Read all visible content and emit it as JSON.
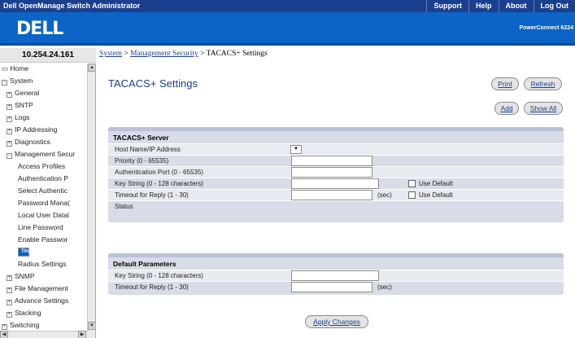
{
  "topbar": {
    "app_title": "Dell OpenManage Switch Administrator",
    "links": [
      "Support",
      "Help",
      "About",
      "Log Out"
    ]
  },
  "header": {
    "logo": "DELL",
    "product": "PowerConnect 6224"
  },
  "left": {
    "ip": "10.254.24.161",
    "nav": [
      {
        "label": "Home",
        "level": 0,
        "type": "leaf-icon"
      },
      {
        "label": "System",
        "level": 0,
        "type": "expanded"
      },
      {
        "label": "General",
        "level": 1,
        "type": "collapsed"
      },
      {
        "label": "SNTP",
        "level": 1,
        "type": "collapsed"
      },
      {
        "label": "Logs",
        "level": 1,
        "type": "collapsed"
      },
      {
        "label": "IP Addressing",
        "level": 1,
        "type": "collapsed"
      },
      {
        "label": "Diagnostics",
        "level": 1,
        "type": "collapsed"
      },
      {
        "label": "Management Secur",
        "level": 1,
        "type": "expanded"
      },
      {
        "label": "Access Profiles",
        "level": 2,
        "type": "leaf"
      },
      {
        "label": "Authentication P",
        "level": 2,
        "type": "leaf"
      },
      {
        "label": "Select Authentic",
        "level": 2,
        "type": "leaf"
      },
      {
        "label": "Password Mana(",
        "level": 2,
        "type": "leaf"
      },
      {
        "label": "Local User Datal",
        "level": 2,
        "type": "leaf"
      },
      {
        "label": "Line Password",
        "level": 2,
        "type": "leaf"
      },
      {
        "label": "Enable Passwor",
        "level": 2,
        "type": "leaf"
      },
      {
        "label": "TACACS+ Setti",
        "level": 2,
        "type": "selected"
      },
      {
        "label": "Radius Settings",
        "level": 2,
        "type": "leaf"
      },
      {
        "label": "SNMP",
        "level": 1,
        "type": "collapsed"
      },
      {
        "label": "File Management",
        "level": 1,
        "type": "collapsed"
      },
      {
        "label": "Advance Settings",
        "level": 1,
        "type": "collapsed"
      },
      {
        "label": "Stacking",
        "level": 1,
        "type": "collapsed"
      },
      {
        "label": "Switching",
        "level": 0,
        "type": "collapsed"
      }
    ]
  },
  "breadcrumb": {
    "system": "System",
    "sep1": " > ",
    "mgmt": "Management Security",
    "sep2": " > ",
    "current": "TACACS+ Settings"
  },
  "page": {
    "title": "TACACS+ Settings",
    "buttons": {
      "print": "Print",
      "refresh": "Refresh",
      "add": "Add",
      "show_all": "Show All",
      "apply": "Apply Changes"
    }
  },
  "server_panel": {
    "title": "TACACS+ Server",
    "host_label": "Host Name/IP Address",
    "priority_label": "Priority (0 - 65535)",
    "priority_value": "",
    "auth_port_label": "Authentication Port (0 - 65535)",
    "auth_port_value": "",
    "key_label": "Key String (0 - 128 characters)",
    "key_value": "",
    "key_use_default": "Use Default",
    "timeout_label": "Timeout for Reply (1 - 30)",
    "timeout_value": "",
    "timeout_unit": "(sec)",
    "timeout_use_default": "Use Default",
    "status_label": "Status"
  },
  "default_panel": {
    "title": "Default Parameters",
    "key_label": "Key String (0 - 128 characters)",
    "key_value": "",
    "timeout_label": "Timeout for Reply (1 - 30)",
    "timeout_value": "",
    "timeout_unit": "(sec)"
  }
}
